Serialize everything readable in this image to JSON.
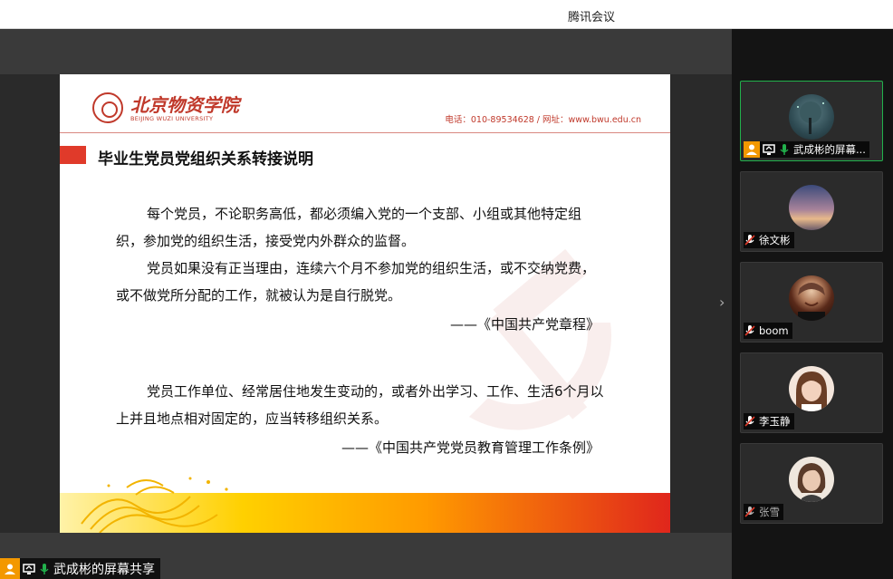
{
  "window": {
    "title": "腾讯会议"
  },
  "slide": {
    "logo_cn": "北京物资学院",
    "logo_en": "BEIJING WUZI UNIVERSITY",
    "contact": "电话：010-89534628 / 网址：www.bwu.edu.cn",
    "heading": "毕业生党员党组织关系转接说明",
    "para1": "每个党员，不论职务高低，都必须编入党的一个支部、小组或其他特定组织，参加党的组织生活，接受党内外群众的监督。",
    "para2": "党员如果没有正当理由，连续六个月不参加党的组织生活，或不交纳党费，或不做党所分配的工作，就被认为是自行脱党。",
    "quote1": "——《中国共产党章程》",
    "para3": "党员工作单位、经常居住地发生变动的，或者外出学习、工作、生活6个月以上并且地点相对固定的，应当转移组织关系。",
    "quote2": "——《中国共产党党员教育管理工作条例》"
  },
  "share": {
    "label": "武成彬的屏幕共享"
  },
  "participants": [
    {
      "name": "武成彬的屏幕...",
      "muted": false,
      "host": true,
      "sharing": true,
      "active": true
    },
    {
      "name": "徐文彬",
      "muted": true
    },
    {
      "name": "boom",
      "muted": true
    },
    {
      "name": "李玉静",
      "muted": true
    },
    {
      "name": "张雪",
      "muted": true,
      "dim": true
    }
  ],
  "colors": {
    "accent_green": "#22b14c",
    "host_orange": "#f39800",
    "brand_red": "#c0392b"
  }
}
